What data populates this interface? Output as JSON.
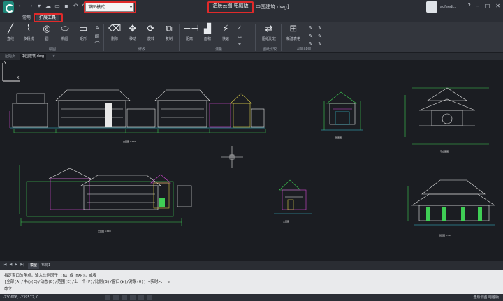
{
  "titlebar": {
    "mode_value": "草图模式",
    "brand": "浩辰云图 电脑版",
    "file_title": "中国建筑.dwg]",
    "user_name": "aofeedi...",
    "window_controls": [
      "?",
      "–",
      "□",
      "✕"
    ]
  },
  "ribbon_tabs": [
    "常用",
    "扩展工具"
  ],
  "ribbon_active_tab": "扩展工具",
  "tools": {
    "line": "直线",
    "polyline": "多段线",
    "circle": "圆",
    "ellipse": "椭圆",
    "rectangle": "矩形",
    "delete": "删除",
    "move": "移动",
    "rotate": "旋转",
    "copy": "复制",
    "distance": "距离",
    "area": "面积",
    "quick": "快速",
    "compare": "图纸比较",
    "new_table": "新建表格"
  },
  "groups": {
    "draw": "绘图",
    "modify": "修改",
    "measure": "测量",
    "compare": "图纸比较",
    "xstable": "XlsTable"
  },
  "file_tabs": [
    "起始页",
    "中国建筑.dwg"
  ],
  "file_tab_close": "×",
  "drawing_labels": {
    "elevation_a": "立面图 1:100",
    "section_a": "剖面图",
    "elevation_b": "立面图 1:100",
    "elevation_c": "立面图",
    "section_b": "剖面图 1:50",
    "pavilion": "亭立面图"
  },
  "layout_tabs": [
    "模型",
    "布局1"
  ],
  "layout_nav": [
    "|◀",
    "◀",
    "▶",
    "▶|"
  ],
  "command": {
    "line1": "指定窗口的角点，输入比例因子 (nX 或 nXP)，或者",
    "line2": "[全部(A)/中心(C)/动态(D)/范围(E)/上一个(P)/比例(S)/窗口(W)/对象(O)] <实时>: _e",
    "prompt": "命令:"
  },
  "status": {
    "coords": "-230606, -239572, 0",
    "brand": "浩辰云图 电脑版"
  },
  "colors": {
    "canvas": "#1b1d22",
    "highlight": "#e02a2a",
    "cad_white": "#e8e8e8",
    "cad_cyan": "#39c6d9",
    "cad_magenta": "#d84ad8",
    "cad_green": "#3fce55",
    "cad_yellow": "#e3d34a"
  }
}
